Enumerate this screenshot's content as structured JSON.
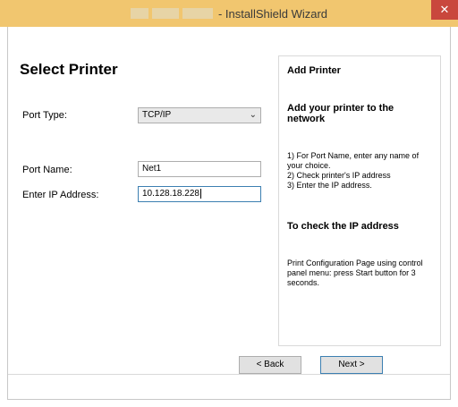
{
  "window": {
    "title": "- InstallShield Wizard",
    "close_glyph": "✕"
  },
  "page": {
    "heading": "Select Printer"
  },
  "form": {
    "port_type": {
      "label": "Port Type:",
      "value": "TCP/IP"
    },
    "port_name": {
      "label": "Port Name:",
      "value": "Net1"
    },
    "ip_address": {
      "label": "Enter IP Address:",
      "value": "10.128.18.228"
    }
  },
  "help": {
    "title": "Add Printer",
    "subtitle": "Add your printer to the network",
    "steps": [
      "1) For Port Name, enter any name of your choice.",
      "2) Check printer's IP address",
      "3) Enter the IP address."
    ],
    "check_title": "To check the IP address",
    "check_body": "Print Configuration Page using control panel menu: press Start button for 3 seconds."
  },
  "buttons": {
    "back": "< Back",
    "next": "Next >"
  },
  "colors": {
    "titlebar": "#f1c66f",
    "close": "#c9473d",
    "focus_border": "#3c7fb1"
  }
}
